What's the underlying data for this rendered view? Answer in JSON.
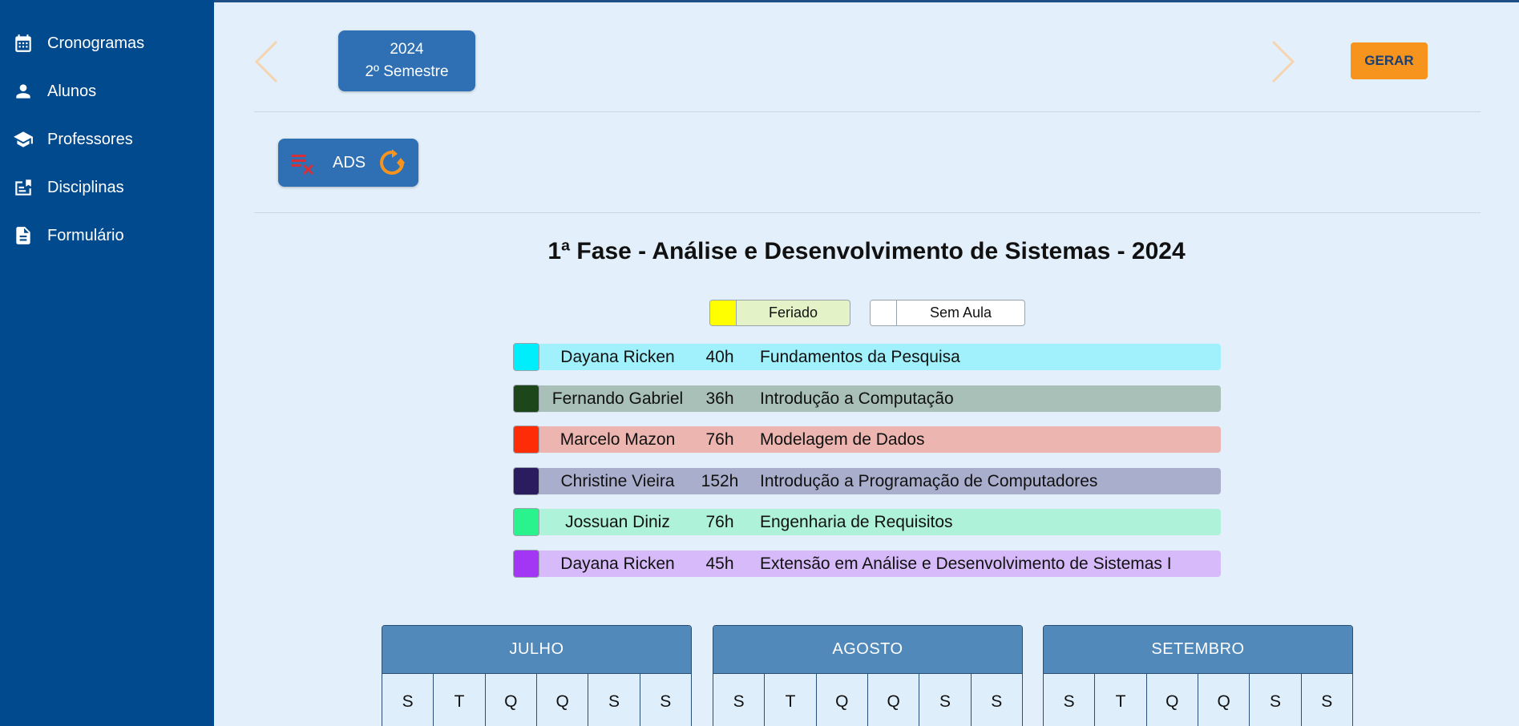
{
  "sidebar": {
    "items": [
      {
        "label": "Cronogramas",
        "icon": "calendar-icon"
      },
      {
        "label": "Alunos",
        "icon": "person-icon"
      },
      {
        "label": "Professores",
        "icon": "graduation-cap-icon"
      },
      {
        "label": "Disciplinas",
        "icon": "book-icon"
      },
      {
        "label": "Formulário",
        "icon": "document-icon"
      }
    ]
  },
  "header": {
    "year": "2024",
    "semester": "2º Semestre",
    "generate_label": "GERAR"
  },
  "course": {
    "code": "ADS"
  },
  "schedule": {
    "title": "1ª Fase - Análise e Desenvolvimento de Sistemas - 2024",
    "legend": [
      {
        "label": "Feriado",
        "swatch": "#ffff00",
        "bg": "#e4f2c8"
      },
      {
        "label": "Sem Aula",
        "swatch": "#ffffff",
        "bg": "#ffffff"
      }
    ],
    "teachers": [
      {
        "name": "Dayana Ricken",
        "hours": "40h",
        "discipline": "Fundamentos da Pesquisa",
        "color": "#00eefc",
        "bg": "#a0f1fb"
      },
      {
        "name": "Fernando Gabriel",
        "hours": "36h",
        "discipline": "Introdução a Computação",
        "color": "#1d471a",
        "bg": "#a8c0b8"
      },
      {
        "name": "Marcelo Mazon",
        "hours": "76h",
        "discipline": "Modelagem de Dados",
        "color": "#ff2d07",
        "bg": "#ecb5b0"
      },
      {
        "name": "Christine Vieira",
        "hours": "152h",
        "discipline": "Introdução a Programação de Computadores",
        "color": "#2b1b5f",
        "bg": "#a9aecd"
      },
      {
        "name": "Jossuan Diniz",
        "hours": "76h",
        "discipline": "Engenharia de Requisitos",
        "color": "#2af28c",
        "bg": "#aef3d9"
      },
      {
        "name": "Dayana Ricken",
        "hours": "45h",
        "discipline": "Extensão em Análise e Desenvolvimento de Sistemas I",
        "color": "#a335f5",
        "bg": "#d6baf9"
      }
    ]
  },
  "calendar": {
    "weekdays": [
      "S",
      "T",
      "Q",
      "Q",
      "S",
      "S"
    ],
    "months": [
      "JULHO",
      "AGOSTO",
      "SETEMBRO"
    ]
  },
  "colors": {
    "sidebar": "#014a8e",
    "accent": "#2f6fb3",
    "generate_button": "#f7941d",
    "month_header": "#5189bb",
    "background": "#e3effa"
  }
}
